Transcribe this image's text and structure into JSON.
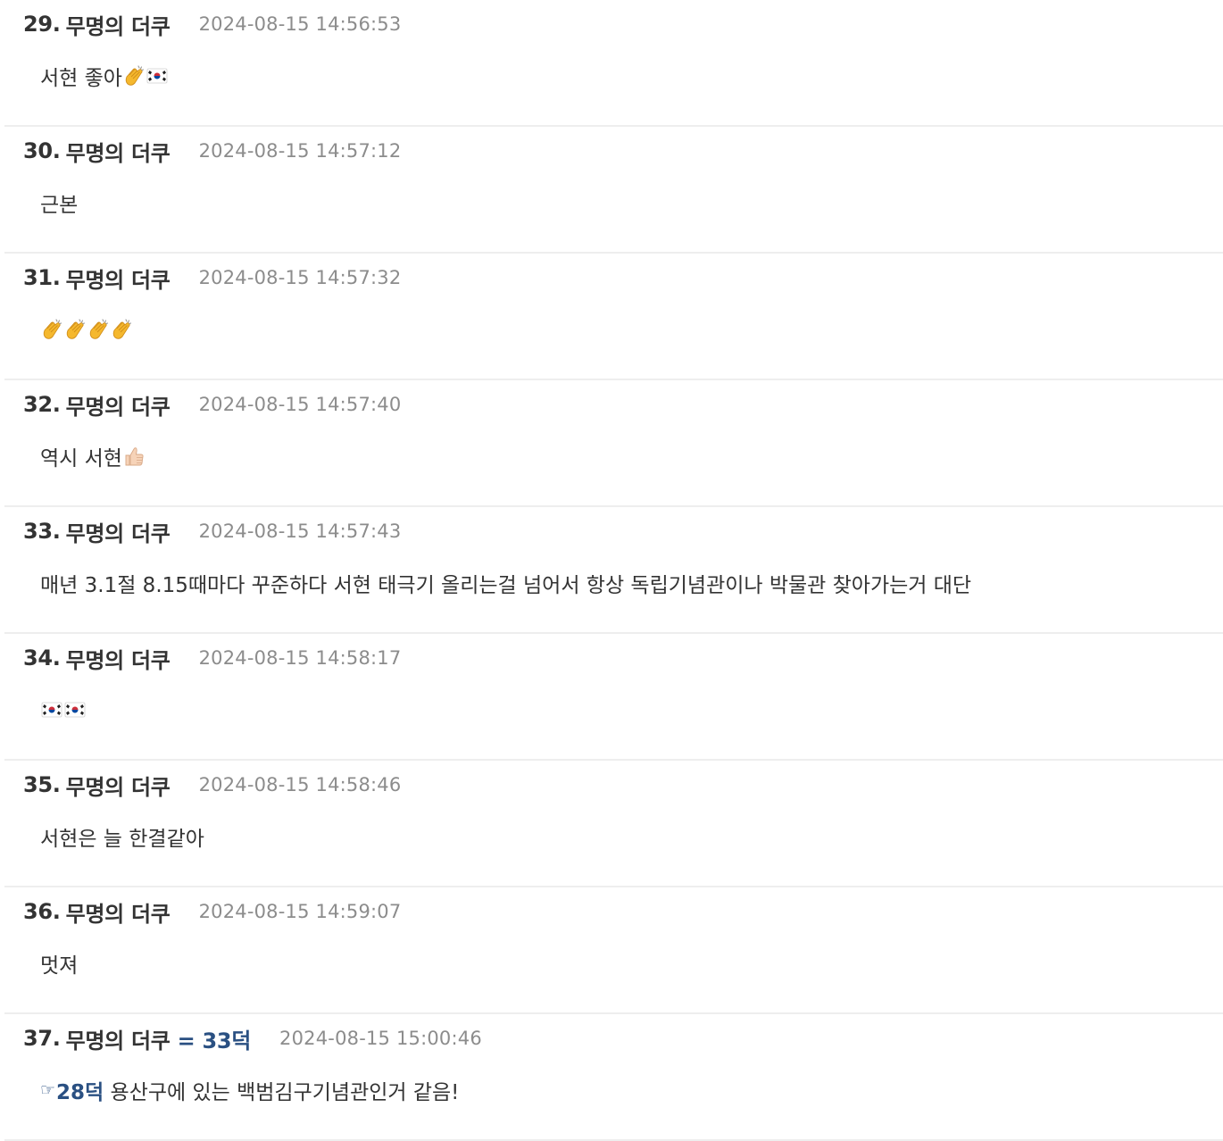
{
  "comments": [
    {
      "num": "29.",
      "author": "무명의 더쿠",
      "date": "2024-08-15 14:56:53",
      "text": "서현 좋아"
    },
    {
      "num": "30.",
      "author": "무명의 더쿠",
      "date": "2024-08-15 14:57:12",
      "text": "근본"
    },
    {
      "num": "31.",
      "author": "무명의 더쿠",
      "date": "2024-08-15 14:57:32",
      "text": ""
    },
    {
      "num": "32.",
      "author": "무명의 더쿠",
      "date": "2024-08-15 14:57:40",
      "text": "역시 서현"
    },
    {
      "num": "33.",
      "author": "무명의 더쿠",
      "date": "2024-08-15 14:57:43",
      "text": "매년 3.1절 8.15때마다 꾸준하다 서현 태극기 올리는걸 넘어서 항상 독립기념관이나 박물관 찾아가는거 대단"
    },
    {
      "num": "34.",
      "author": "무명의 더쿠",
      "date": "2024-08-15 14:58:17",
      "text": ""
    },
    {
      "num": "35.",
      "author": "무명의 더쿠",
      "date": "2024-08-15 14:58:46",
      "text": "서현은 늘 한결같아"
    },
    {
      "num": "36.",
      "author": "무명의 더쿠",
      "date": "2024-08-15 14:59:07",
      "text": "멋져"
    },
    {
      "num": "37.",
      "author": "무명의 더쿠",
      "reply_to": "= 33덕",
      "date": "2024-08-15 15:00:46",
      "reply_link": "28덕",
      "text": " 용산구에 있는 백범김구기념관인거 같음!"
    }
  ],
  "icons": {
    "clap": "clapping-hands-emoji",
    "flag": "south-korea-flag-emoji",
    "thumbs": "thumbs-up-emoji",
    "pointer": "☞"
  },
  "colors": {
    "text": "#333333",
    "date": "#8c8c8c",
    "reply": "#2a5082",
    "divider": "#eeeeee"
  }
}
